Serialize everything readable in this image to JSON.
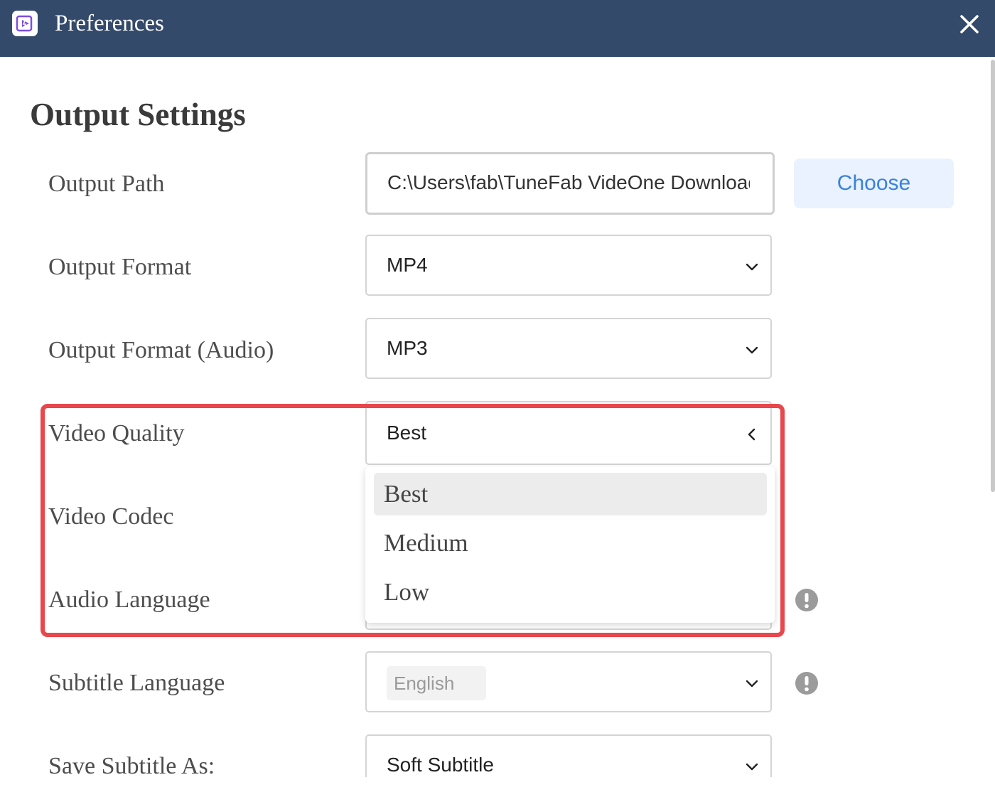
{
  "window": {
    "title": "Preferences"
  },
  "section_title": "Output Settings",
  "rows": [
    {
      "label": "Output Path"
    },
    {
      "label": "Output Format",
      "value": "MP4"
    },
    {
      "label": "Output Format (Audio)",
      "value": "MP3"
    },
    {
      "label": "Video Quality",
      "value": "Best"
    },
    {
      "label": "Video Codec"
    },
    {
      "label": "Audio Language"
    },
    {
      "label": "Subtitle Language",
      "value": "English"
    },
    {
      "label": "Save Subtitle As:",
      "value": "Soft Subtitle"
    }
  ],
  "output_path": {
    "value": "C:\\Users\\fab\\TuneFab VideOne Downloader",
    "button": "Choose"
  },
  "quality_dropdown": {
    "options": [
      "Best",
      "Medium",
      "Low"
    ],
    "selected": "Best"
  },
  "colors": {
    "titlebar": "#344a6a",
    "accent": "#3a82de",
    "highlight": "#e8474b"
  },
  "icons": [
    "app-logo-icon",
    "close-icon",
    "chevron-down-icon",
    "chevron-left-icon",
    "info-icon"
  ]
}
